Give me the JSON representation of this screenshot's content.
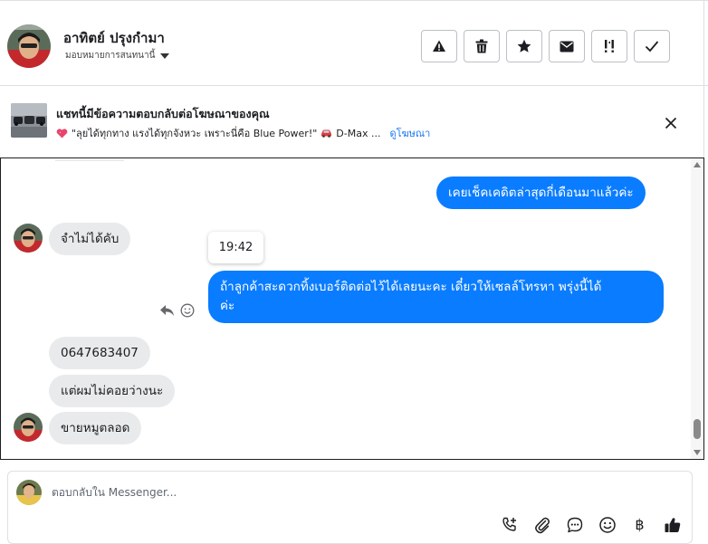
{
  "header": {
    "contact_name": "อาทิตย์ ปรุงกำมา",
    "assignment_label": "มอบหมายการสนทนานี้",
    "actions": [
      {
        "name": "spam-warning",
        "icon": "warning-triangle-icon"
      },
      {
        "name": "delete",
        "icon": "trash-icon"
      },
      {
        "name": "star",
        "icon": "star-icon"
      },
      {
        "name": "mark-unread",
        "icon": "envelope-icon"
      },
      {
        "name": "follow-up",
        "icon": "exclamation-icon"
      },
      {
        "name": "mark-done",
        "icon": "checkmark-icon"
      }
    ]
  },
  "ad_banner": {
    "title": "แชทนี้มีข้อความตอบกลับต่อโฆษณาของคุณ",
    "heart_icon": "heart-icon",
    "ad_text": "\"ลุยได้ทุกทาง แรงได้ทุกจังหวะ เพราะนี่คือ Blue Power!\"",
    "car_icon": "car-icon",
    "ad_text_tail": "D-Max ...",
    "view_ad_link": "ดูโฆษณา",
    "close_icon": "close-icon"
  },
  "conversation": {
    "messages": [
      {
        "direction": "out",
        "text": "เคยเช็คเคดิตล่าสุดกี่เดือนมาแล้วค่ะ"
      },
      {
        "direction": "in",
        "text": "จำไม่ได้คับ"
      },
      {
        "direction": "out",
        "line1": "ถ้าลูกค้าสะดวกทิ้งเบอร์ติดต่อไว้ได้เลยนะคะ เดี๋ยวให้เซลล์โทรหา พรุ่งนี้ได้",
        "line2": "ค่ะ"
      },
      {
        "direction": "in",
        "text": "0647683407"
      },
      {
        "direction": "in",
        "text": "แต่ผมไม่คอยว่างนะ"
      },
      {
        "direction": "in",
        "text": "ขายหมูตลอด"
      }
    ],
    "tooltip_time": "19:42",
    "hover_actions": [
      "reply-icon",
      "emoji-react-icon"
    ]
  },
  "composer": {
    "placeholder": "ตอบกลับใน Messenger...",
    "tools": [
      "call-icon",
      "attachment-icon",
      "saved-replies-icon",
      "emoji-icon",
      "baht-icon",
      "thumbs-up-icon"
    ],
    "baht_symbol": "฿"
  },
  "colors": {
    "outgoing_bubble": "#0a7cff",
    "incoming_bubble": "#e9eaec",
    "link": "#1877f2"
  }
}
